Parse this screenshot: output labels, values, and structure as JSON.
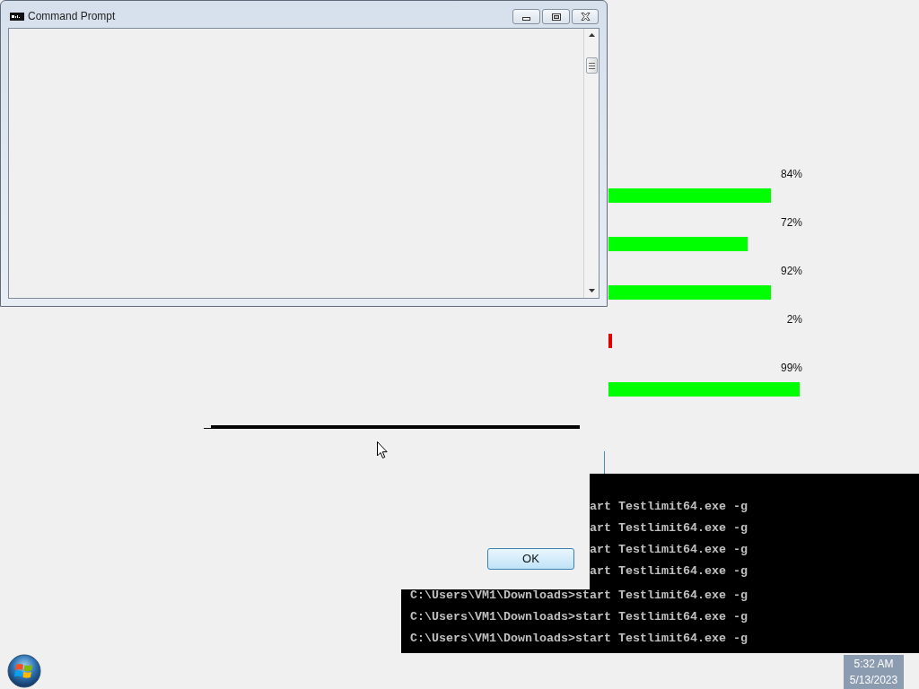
{
  "command_prompt": {
    "title": "Command Prompt"
  },
  "meters": [
    {
      "label": "84%",
      "level": 0.84,
      "color": "#00ff00"
    },
    {
      "label": "72%",
      "level": 0.72,
      "color": "#00ff00"
    },
    {
      "label": "92%",
      "level": 0.84,
      "color": "#00ff00"
    },
    {
      "label": "2%",
      "level": 0.02,
      "color": "#e00000"
    },
    {
      "label": "99%",
      "level": 0.99,
      "color": "#00ff00"
    }
  ],
  "dialog": {
    "ok_button": "OK"
  },
  "console": {
    "upper_lines": [
      "art Testlimit64.exe -g",
      "art Testlimit64.exe -g",
      "art Testlimit64.exe -g",
      "art Testlimit64.exe -g"
    ],
    "lower_lines": [
      "C:\\Users\\VM1\\Downloads>start Testlimit64.exe -g",
      "C:\\Users\\VM1\\Downloads>start Testlimit64.exe -g",
      "C:\\Users\\VM1\\Downloads>start Testlimit64.exe -g"
    ]
  },
  "taskbar": {
    "clock": {
      "time": "5:32 AM",
      "date": "5/13/2023"
    }
  }
}
